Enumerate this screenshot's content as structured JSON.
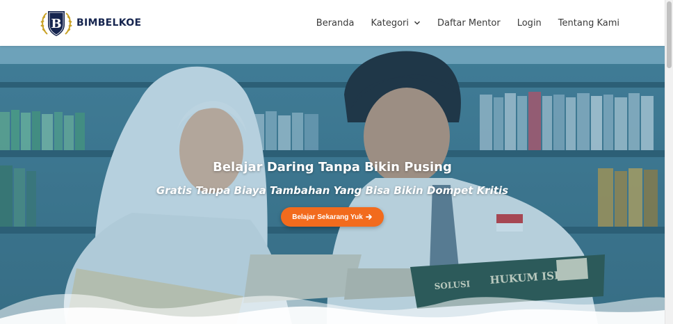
{
  "header": {
    "brand_name": "BIMBELKOE",
    "logo_letter": "B",
    "logo_icon": "shield-laurel-logo-icon"
  },
  "nav": {
    "items": [
      {
        "label": "Beranda"
      },
      {
        "label": "Kategori",
        "has_dropdown": true,
        "icon": "chevron-down-icon"
      },
      {
        "label": "Daftar Mentor"
      },
      {
        "label": "Login"
      },
      {
        "label": "Tentang Kami"
      }
    ]
  },
  "hero": {
    "title": "Belajar Daring Tanpa Bikin Pusing",
    "subtitle": "Gratis Tanpa Biaya Tambahan Yang Bisa Bikin Dompet Kritis",
    "cta_label": "Belajar Sekarang Yuk",
    "cta_icon": "arrow-right-icon",
    "photo_description_icon": "students-reading-photo",
    "book_title": "HUKUM ISLAM",
    "book_subtitle": "SOLUSI"
  },
  "colors": {
    "brand_navy": "#16254f",
    "logo_gold": "#c9a227",
    "cta_orange": "#f26b1d",
    "hero_tint": "#2878a0",
    "nav_text": "#3a3a3a"
  }
}
